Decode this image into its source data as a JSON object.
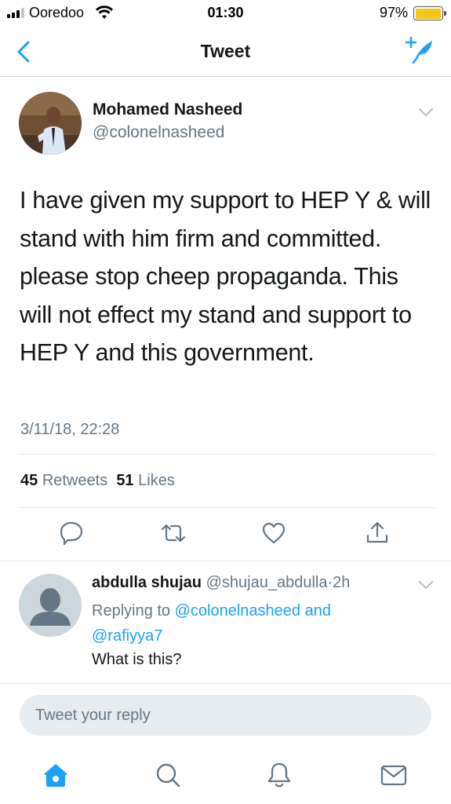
{
  "status_bar": {
    "carrier": "Ooredoo",
    "time": "01:30",
    "battery_percent": "97%",
    "battery_level": 0.97,
    "icons": [
      "signal-icon",
      "wifi-icon",
      "battery-icon"
    ]
  },
  "navbar": {
    "title": "Tweet",
    "back_icon": "chevron-left-icon",
    "compose_icon": "compose-tweet-icon"
  },
  "tweet": {
    "author_name": "Mohamed Nasheed",
    "author_handle": "@colonelnasheed",
    "text": "I have given my support to HEP Y & will stand with him firm and committed. please stop cheep propaganda. This will not effect my stand and support to HEP Y and this government.",
    "timestamp": "3/11/18, 22:28",
    "retweets_count": "45",
    "retweets_label": "Retweets",
    "likes_count": "51",
    "likes_label": "Likes"
  },
  "actions": [
    "reply-icon",
    "retweet-icon",
    "like-icon",
    "share-icon"
  ],
  "reply": {
    "author_name": "abdulla shujau",
    "author_handle": "@shujau_abdulla",
    "separator": "·",
    "age": "2h",
    "replying_prefix": "Replying to",
    "replying_to_1": "@colonelnasheed",
    "replying_and": "and",
    "replying_to_2": "@rafiyya7",
    "text": "What is this?"
  },
  "composer": {
    "placeholder": "Tweet your reply"
  },
  "tabbar": {
    "tabs": [
      "home-icon",
      "search-icon",
      "notifications-icon",
      "messages-icon"
    ],
    "active": "home-icon"
  },
  "colors": {
    "accent": "#1da1f2",
    "text": "#14171a",
    "secondary_text": "#657786",
    "battery": "#f5c518"
  }
}
